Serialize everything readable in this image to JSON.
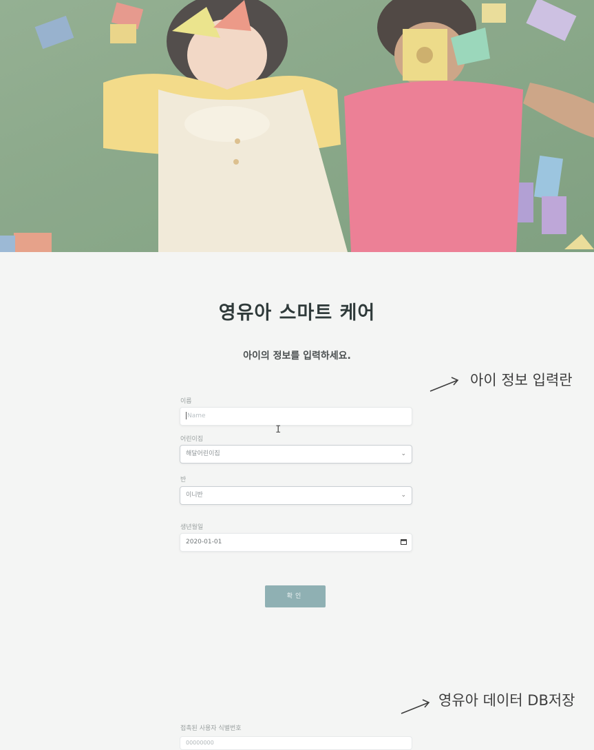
{
  "header": {
    "title": "영유아 스마트 케어",
    "subtitle": "아이의 정보를 입력하세요."
  },
  "form": {
    "name": {
      "label": "이름",
      "placeholder": "Name",
      "value": ""
    },
    "daycare": {
      "label": "어린이집",
      "selected": "해달어린이집"
    },
    "class": {
      "label": "반",
      "selected": "이니반"
    },
    "birthdate": {
      "label": "생년월일",
      "value": "2020-01-01"
    },
    "submit_label": "확인"
  },
  "annotations": {
    "child_info": "아이 정보 입력란",
    "db_save": "영유아 데이터 DB저장"
  },
  "bottom": {
    "label": "접촉된 사용자 식별번호",
    "value": "00000000"
  }
}
